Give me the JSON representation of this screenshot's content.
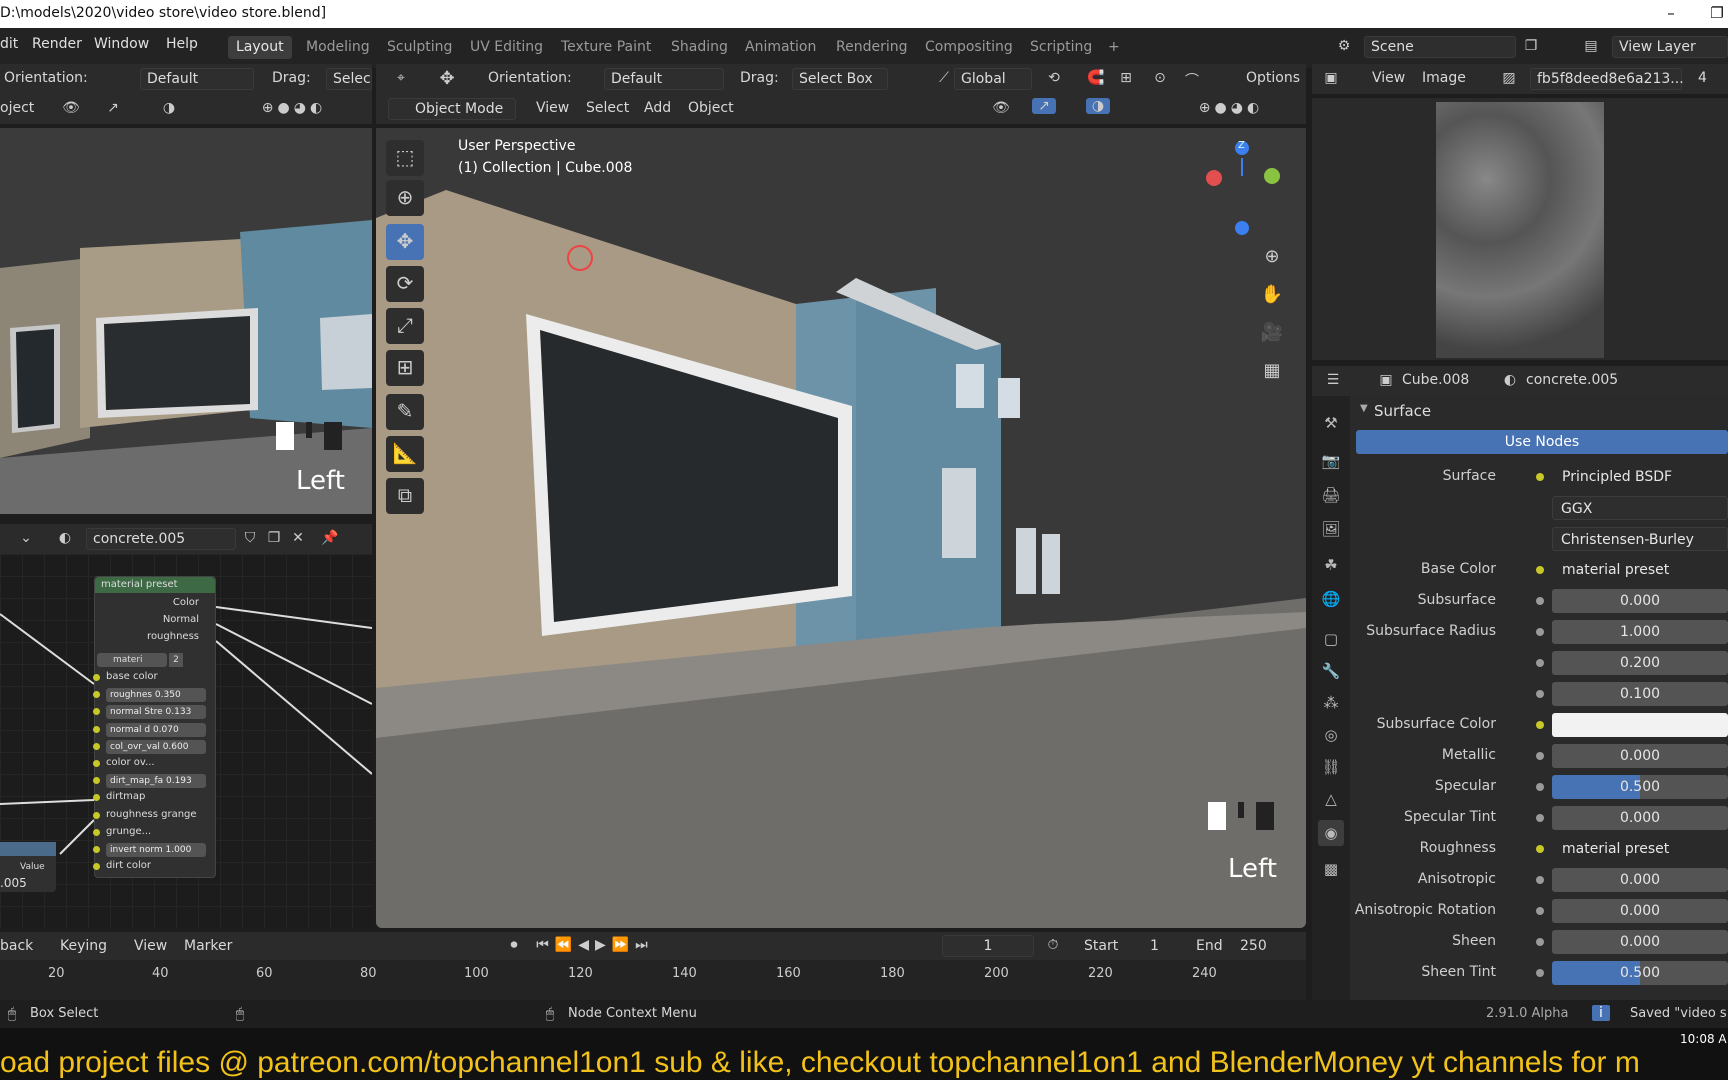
{
  "window": {
    "title": "D:\\models\\2020\\video store\\video store.blend]",
    "minimize": "–",
    "restore": "❐",
    "close": "✕"
  },
  "menu": [
    "dit",
    "Render",
    "Window",
    "Help"
  ],
  "workspaces": [
    "Layout",
    "Modeling",
    "Sculpting",
    "UV Editing",
    "Texture Paint",
    "Shading",
    "Animation",
    "Rendering",
    "Compositing",
    "Scripting",
    "+"
  ],
  "scene": {
    "label": "Scene",
    "view_layer": "View Layer"
  },
  "left_viewport": {
    "orientation_label": "Orientation:",
    "orientation_value": "Default",
    "drag_label": "Drag:",
    "drag_value": "Selec",
    "mode": "oject",
    "overlay_text": "Left"
  },
  "main_viewport": {
    "orientation_label": "Orientation:",
    "orientation_value": "Default",
    "drag_label": "Drag:",
    "drag_value": "Select Box",
    "transform": "Global",
    "options": "Options",
    "mode": "Object Mode",
    "menus": [
      "View",
      "Select",
      "Add",
      "Object"
    ],
    "perspective": "User Perspective",
    "collection": "(1) Collection | Cube.008",
    "overlay_text": "Left",
    "gizmo_axis": "Z"
  },
  "image_editor": {
    "menus": [
      "View",
      "Image"
    ],
    "image_name": "fb5f8deed8e6a213...",
    "users": "4"
  },
  "node_editor": {
    "material": "concrete.005",
    "node_title": "material preset",
    "outputs": [
      "Color",
      "Normal",
      "roughness"
    ],
    "group_field": "materi",
    "group_users": "2",
    "inputs": [
      {
        "label": "base color",
        "value": ""
      },
      {
        "label": "roughnes",
        "value": "0.350"
      },
      {
        "label": "normal Stre",
        "value": "0.133"
      },
      {
        "label": "normal d",
        "value": "0.070"
      },
      {
        "label": "col_ovr_val",
        "value": "0.600"
      },
      {
        "label": "color ov...",
        "value": ""
      },
      {
        "label": "dirt_map_fa",
        "value": "0.193"
      },
      {
        "label": "dirtmap",
        "value": ""
      },
      {
        "label": "roughness grange",
        "value": ""
      },
      {
        "label": "grunge...",
        "value": ""
      },
      {
        "label": "invert norm",
        "value": "1.000"
      },
      {
        "label": "dirt color",
        "value": ""
      }
    ],
    "value_node": {
      "label": "Value",
      "value": ".005"
    }
  },
  "properties": {
    "object": "Cube.008",
    "material": "concrete.005",
    "panel": "Surface",
    "use_nodes": "Use Nodes",
    "rows": [
      {
        "label": "Surface",
        "value": "Principled BSDF",
        "kind": "txt"
      },
      {
        "label": "",
        "value": "GGX",
        "kind": "dd"
      },
      {
        "label": "",
        "value": "Christensen-Burley",
        "kind": "dd"
      },
      {
        "label": "Base Color",
        "value": "material preset",
        "kind": "txt"
      },
      {
        "label": "Subsurface",
        "value": "0.000",
        "kind": "num"
      },
      {
        "label": "Subsurface Radius",
        "value": "1.000",
        "kind": "num"
      },
      {
        "label": "",
        "value": "0.200",
        "kind": "num"
      },
      {
        "label": "",
        "value": "0.100",
        "kind": "num"
      },
      {
        "label": "Subsurface Color",
        "value": "",
        "kind": "color"
      },
      {
        "label": "Metallic",
        "value": "0.000",
        "kind": "num"
      },
      {
        "label": "Specular",
        "value": "0.500",
        "kind": "blue"
      },
      {
        "label": "Specular Tint",
        "value": "0.000",
        "kind": "num"
      },
      {
        "label": "Roughness",
        "value": "material preset",
        "kind": "txt"
      },
      {
        "label": "Anisotropic",
        "value": "0.000",
        "kind": "num"
      },
      {
        "label": "Anisotropic Rotation",
        "value": "0.000",
        "kind": "num"
      },
      {
        "label": "Sheen",
        "value": "0.000",
        "kind": "num"
      },
      {
        "label": "Sheen Tint",
        "value": "0.500",
        "kind": "blue"
      }
    ]
  },
  "timeline": {
    "playback": "back",
    "keying": "Keying",
    "view": "View",
    "marker": "Marker",
    "current_frame": "1",
    "start_label": "Start",
    "start": "1",
    "end_label": "End",
    "end": "250",
    "ticks": [
      "20",
      "40",
      "60",
      "80",
      "100",
      "120",
      "140",
      "160",
      "180",
      "200",
      "220",
      "240"
    ]
  },
  "status": {
    "left": "Box Select",
    "middle": "Node Context Menu",
    "version": "2.91.0 Alpha",
    "saved": "Saved \"video s"
  },
  "taskbar": {
    "clock": "10:08 A"
  },
  "banner": "oad project files @ patreon.com/topchannel1on1 sub & like, checkout topchannel1on1 and  BlenderMoney yt channels for m",
  "colors": {
    "accent": "#4772b3",
    "socket_yellow": "#c7c729",
    "banner": "#f2c21b"
  }
}
